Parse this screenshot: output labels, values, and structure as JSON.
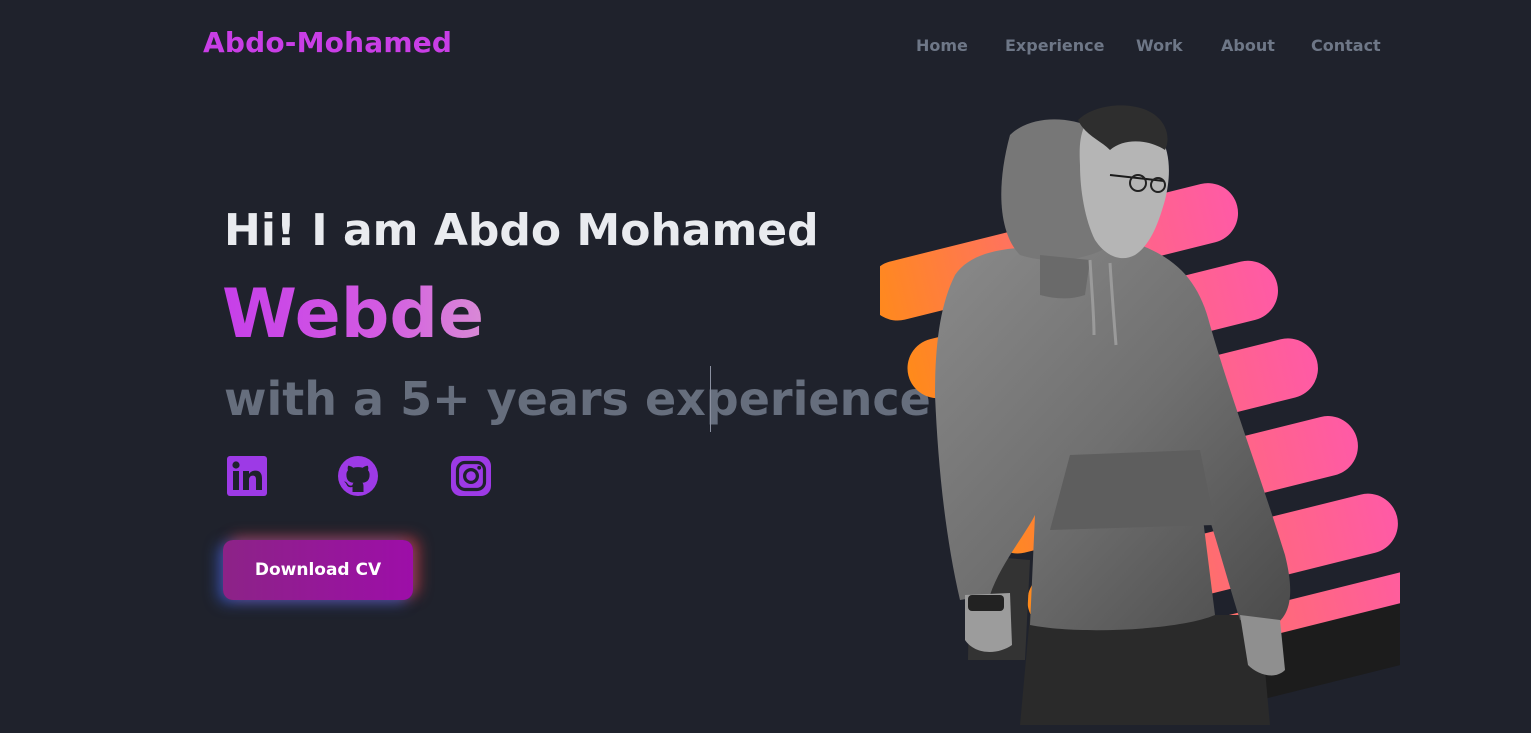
{
  "brand": {
    "name": "Abdo-Mohamed"
  },
  "nav": {
    "items": [
      "Home",
      "Experience",
      "Work",
      "About",
      "Contact"
    ]
  },
  "hero": {
    "greeting": "Hi! I am Abdo Mohamed",
    "typed_text": "Webde",
    "subline": "with a 5+ years experience",
    "cta_label": "Download CV"
  },
  "social": [
    {
      "icon": "linkedin-icon"
    },
    {
      "icon": "github-icon"
    },
    {
      "icon": "instagram-icon"
    }
  ],
  "colors": {
    "background": "#1f222c",
    "brand": "#c93ee6",
    "nav_text": "#6e7787",
    "heading": "#e9ebef",
    "subline": "#666e7d",
    "icon": "#9d3ae6",
    "button_start": "#8c2387",
    "button_end": "#9d0ea8",
    "stripe_orange": "#ff8a1a",
    "stripe_pink": "#ff5aa6"
  }
}
